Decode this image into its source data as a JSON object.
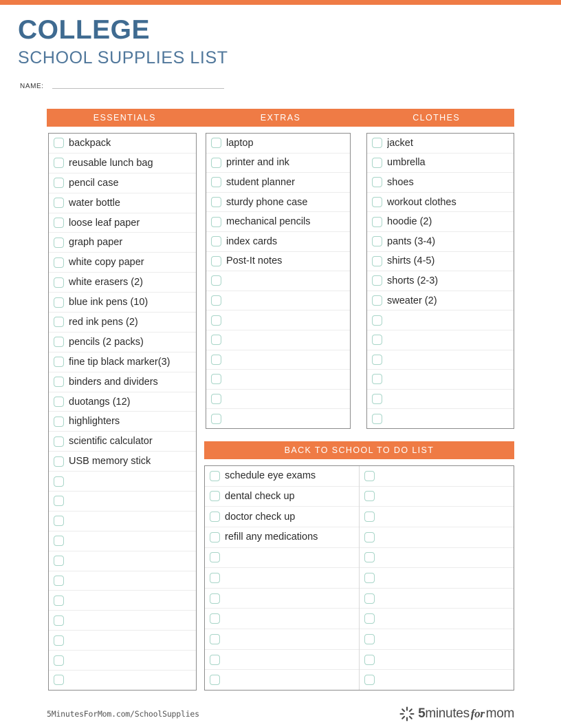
{
  "document": {
    "title_main": "COLLEGE",
    "title_sub": "SCHOOL SUPPLIES LIST",
    "name_label": "NAME:",
    "accent_orange": "#ef7b45",
    "title_blue": "#3f6b91",
    "checkbox_border": "#a8d5c8"
  },
  "headers": {
    "essentials": "ESSENTIALS",
    "extras": "EXTRAS",
    "clothes": "CLOTHES",
    "todo": "BACK TO SCHOOL TO DO LIST"
  },
  "columns": {
    "essentials": {
      "items": [
        "backpack",
        "reusable lunch bag",
        "pencil case",
        "water bottle",
        "loose leaf paper",
        "graph paper",
        "white copy paper",
        "white erasers (2)",
        "blue ink pens (10)",
        "red ink pens (2)",
        "pencils (2 packs)",
        "fine tip black marker(3)",
        "binders and dividers",
        "duotangs (12)",
        "highlighters",
        "scientific calculator",
        "USB memory stick"
      ],
      "blank_rows": 11
    },
    "extras": {
      "items": [
        "laptop",
        "printer and ink",
        "student planner",
        "sturdy phone case",
        "mechanical pencils",
        "index cards",
        "Post-It notes"
      ],
      "blank_rows": 8
    },
    "clothes": {
      "items": [
        "jacket",
        "umbrella",
        "shoes",
        "workout clothes",
        "hoodie (2)",
        "pants (3-4)",
        "shirts (4-5)",
        "shorts (2-3)",
        "sweater (2)"
      ],
      "blank_rows": 6
    },
    "todo_left": {
      "items": [
        "schedule eye exams",
        "dental check up",
        "doctor check up",
        "refill any medications"
      ],
      "blank_rows": 7
    },
    "todo_right": {
      "items": [],
      "blank_rows": 11
    }
  },
  "footer": {
    "url": "5MinutesForMom.com/SchoolSupplies",
    "brand_5": "5",
    "brand_minutes": "minutes",
    "brand_for": "for",
    "brand_mom": "mom"
  }
}
